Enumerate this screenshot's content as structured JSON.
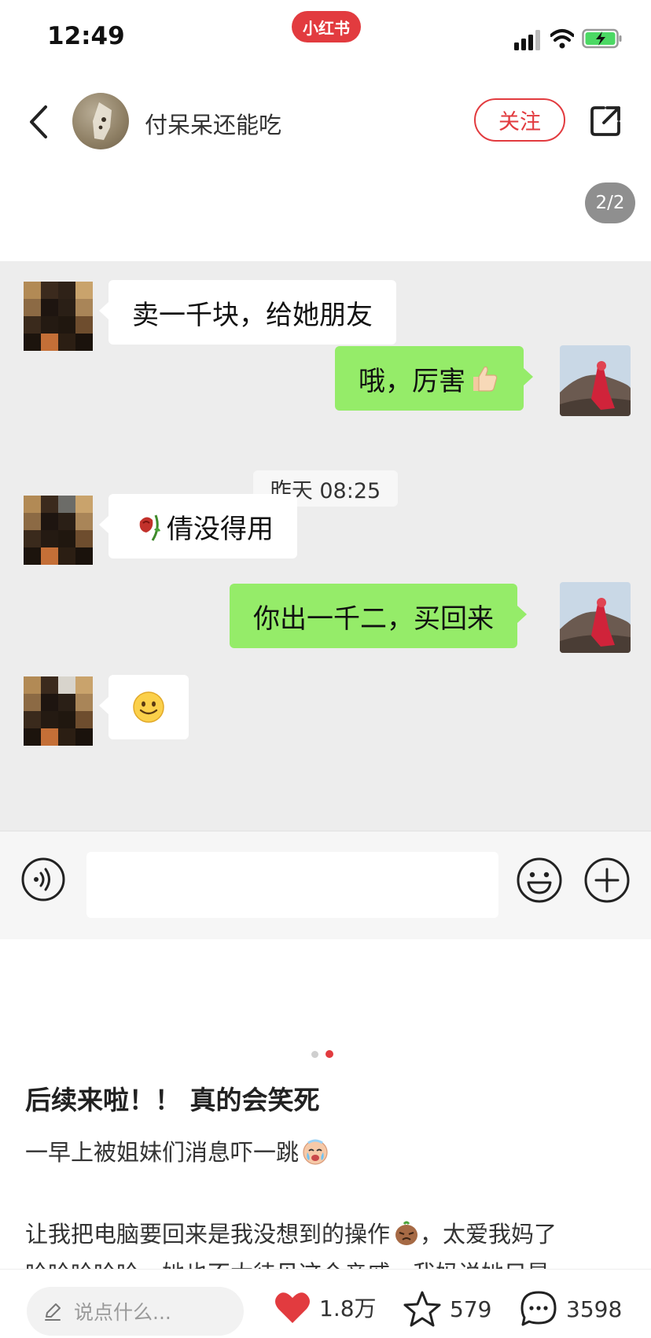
{
  "status_bar": {
    "time": "12:49",
    "app_badge": "小红书"
  },
  "header": {
    "author_name": "付呆呆还能吃",
    "follow_label": "关注",
    "page_counter": "2/2"
  },
  "chat": {
    "messages": [
      {
        "side": "left",
        "text": "卖一千块，给她朋友"
      },
      {
        "side": "right",
        "text": "哦，厉害",
        "emoji": "thumbs-up"
      },
      {
        "side": "left",
        "text": "倩没得用",
        "emoji": "wilted-rose"
      },
      {
        "side": "right",
        "text": "你出一千二，买回来"
      },
      {
        "side": "left",
        "text": "",
        "emoji": "smiling-face"
      }
    ],
    "time_divider": "昨天 08:25"
  },
  "post": {
    "title": "后续来啦！！ 真的会笑死",
    "line1": "一早上被姐妹们消息吓一跳",
    "line2_a": "让我把电脑要回来是我没想到的操作",
    "line2_b": "，太爱我妈了",
    "line3": "哈哈哈哈哈，她也不太待见这个亲戚，我妈说她只是"
  },
  "bottom_bar": {
    "comment_placeholder": "说点什么...",
    "likes": "1.8万",
    "favorites": "579",
    "comments": "3598"
  },
  "colors": {
    "accent": "#e23b3f",
    "chat_green": "#95ec69",
    "chat_bg": "#ededed"
  }
}
